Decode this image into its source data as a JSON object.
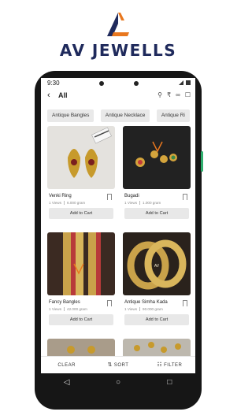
{
  "brand": {
    "name": "AV JEWELLS",
    "colors": {
      "navy": "#1f2a5c",
      "orange": "#e8771e"
    }
  },
  "status_bar": {
    "time": "9:30"
  },
  "header": {
    "back_icon": "arrow-left-icon",
    "title": "All",
    "icons": [
      "search-icon",
      "currency-rupee-icon",
      "link-icon",
      "bookmark-icon"
    ]
  },
  "categories": [
    "Antique Bangles",
    "Antique Necklace",
    "Antique Ri"
  ],
  "products": [
    {
      "name": "Venki Ring",
      "views": "1 Views",
      "weight": "6.000 gram",
      "button": "Add to Cart"
    },
    {
      "name": "Bugadi",
      "views": "1 Views",
      "weight": "1.000 gram",
      "button": "Add to Cart"
    },
    {
      "name": "Fancy Bangles",
      "views": "1 Views",
      "weight": "42.000 gram",
      "button": "Add to Cart"
    },
    {
      "name": "Antique Simha Kada",
      "views": "1 Views",
      "weight": "90.000 gram",
      "button": "Add to Cart"
    },
    {
      "name": "",
      "views": "",
      "weight": "",
      "button": ""
    },
    {
      "name": "",
      "views": "",
      "weight": "",
      "button": ""
    }
  ],
  "actions": {
    "clear": "CLEAR",
    "sort": "SORT",
    "filter": "FILTER"
  },
  "nav": {
    "back": "back-triangle-icon",
    "home": "home-circle-icon",
    "recents": "recents-square-icon"
  }
}
